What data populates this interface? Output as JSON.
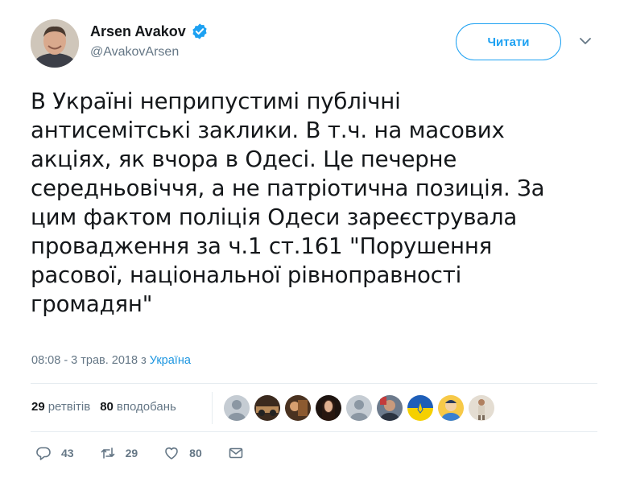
{
  "author": {
    "name": "Arsen Avakov",
    "handle": "@AvakovArsen",
    "verified": true
  },
  "follow_button": {
    "label": "Читати"
  },
  "tweet": {
    "text": "В Україні неприпустимі публічні\nантисемітські заклики. В т.ч. на масових\nакціях, як вчора в Одесі. Це печерне\nсередньовіччя, а не патріотична позиція. За\nцим фактом поліція Одеси зареєструвала\nпровадження за ч.1 ст.161 \"Порушення\nрасової, національної рівноправності\nгромадян\""
  },
  "meta": {
    "time_date": "08:08 - 3 трав. 2018 з ",
    "location": "Україна"
  },
  "stats": {
    "retweets_count": "29",
    "retweets_label": "ретвітів",
    "likes_count": "80",
    "likes_label": "вподобань"
  },
  "actions": {
    "reply_count": "43",
    "retweet_count": "29",
    "like_count": "80"
  },
  "colors": {
    "accent": "#1da1f2",
    "link": "#1b95e0",
    "muted": "#657786",
    "text": "#14171a"
  },
  "icons": [
    "verified-badge-icon",
    "chevron-down-icon",
    "reply-icon",
    "retweet-icon",
    "heart-icon",
    "envelope-icon"
  ]
}
